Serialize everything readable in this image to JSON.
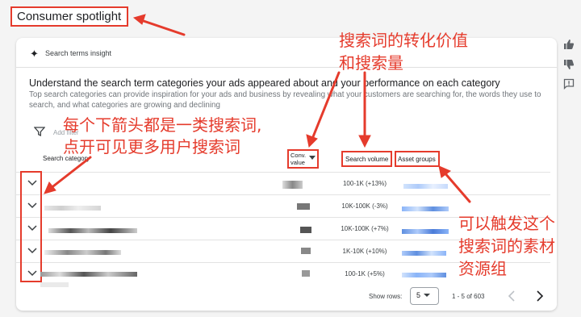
{
  "annotations": {
    "title_box": "Consumer spotlight",
    "note_top_line1": "搜索词的转化价值",
    "note_top_line2": "和搜索量",
    "note_left_line1": "每个下箭头都是一类搜索词,",
    "note_left_line2": "点开可见更多用户搜索词",
    "note_right_line1": "可以触发这个",
    "note_right_line2": "搜索词的素材",
    "note_right_line3": "资源组"
  },
  "card": {
    "insight_label": "Search terms insight",
    "heading": "Understand the search term categories your ads appeared about and your performance on each category",
    "subtext": "Top search categories can provide inspiration for your ads and business by revealing what your customers are searching for, the words they use to search, and what categories are growing and declining",
    "add_filter": "Add filter"
  },
  "table": {
    "headers": {
      "search_category": "Search category",
      "conv_value_line1": "Conv.",
      "conv_value_line2": "value",
      "search_volume": "Search volume",
      "asset_groups": "Asset groups"
    },
    "rows": [
      {
        "search_volume": "100-1K (+13%)"
      },
      {
        "search_volume": "10K-100K (-3%)"
      },
      {
        "search_volume": "10K-100K (+7%)"
      },
      {
        "search_volume": "1K-10K (+10%)"
      },
      {
        "search_volume": "100-1K (+5%)"
      }
    ]
  },
  "footer": {
    "show_rows_label": "Show rows:",
    "rows_value": "5",
    "range_text": "1 - 5 of 603"
  },
  "colors": {
    "annotation_red": "#e53b2c",
    "blur_blue": "#8ab4f8"
  }
}
